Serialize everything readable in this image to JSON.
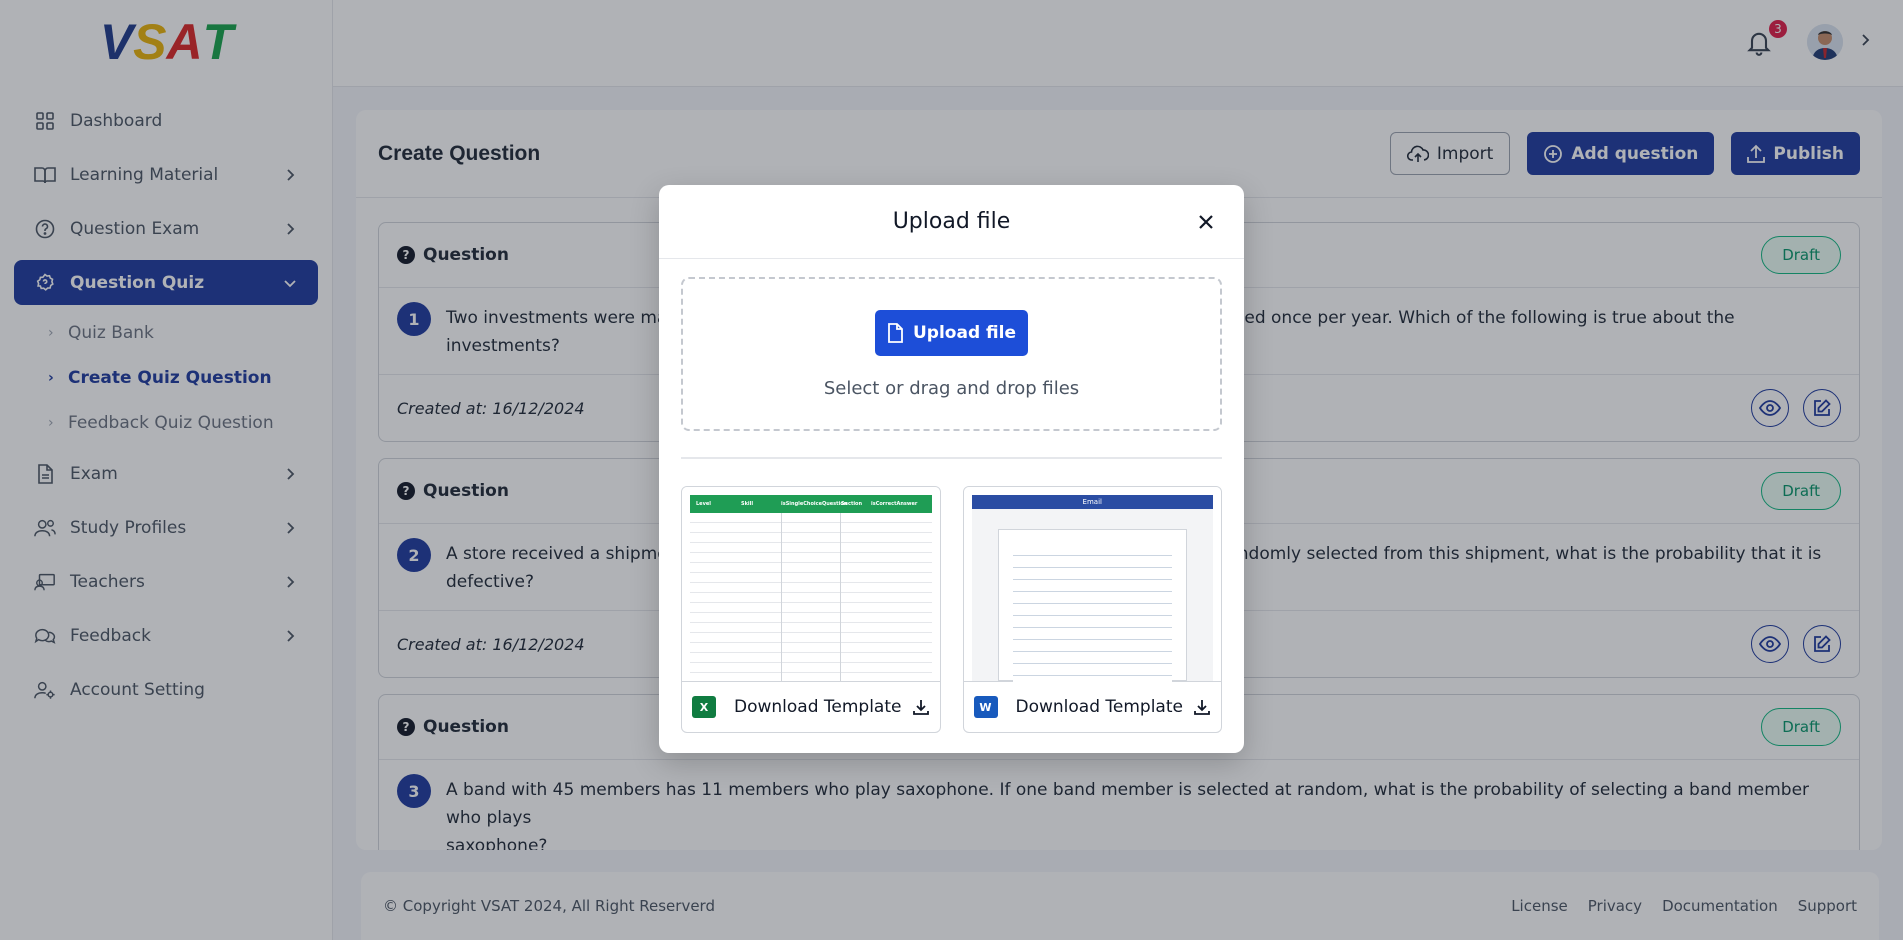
{
  "logo": {
    "text_parts": [
      "V",
      "S",
      "A",
      "T"
    ]
  },
  "sidebar": {
    "items": [
      {
        "label": "Dashboard",
        "icon": "grid-icon"
      },
      {
        "label": "Learning Material",
        "icon": "book-icon"
      },
      {
        "label": "Question Exam",
        "icon": "help-circle-icon"
      },
      {
        "label": "Question Quiz",
        "icon": "quiz-gear-icon"
      },
      {
        "label": "Exam",
        "icon": "document-icon"
      },
      {
        "label": "Study Profiles",
        "icon": "users-icon"
      },
      {
        "label": "Teachers",
        "icon": "teacher-icon"
      },
      {
        "label": "Feedback",
        "icon": "chat-icon"
      },
      {
        "label": "Account Setting",
        "icon": "user-gear-icon"
      }
    ],
    "sub_items": [
      {
        "label": "Quiz Bank"
      },
      {
        "label": "Create Quiz Question"
      },
      {
        "label": "Feedback Quiz Question"
      }
    ]
  },
  "topbar": {
    "notification_count": "3"
  },
  "main": {
    "title": "Create Question",
    "import_label": "Import",
    "add_label": "Add question",
    "publish_label": "Publish",
    "questions": [
      {
        "header": "Question",
        "status": "Draft",
        "number": "1",
        "text_left": "Two investments were ma",
        "text_right": "ed once per year. Which of the following is true about the investments?",
        "created": "Created at: 16/12/2024"
      },
      {
        "header": "Question",
        "status": "Draft",
        "number": "2",
        "text_left": "A store received a shipme",
        "text_right": "ndomly selected from this shipment, what is the probability that it is",
        "text_line2": "defective?",
        "created": "Created at: 16/12/2024"
      },
      {
        "header": "Question",
        "status": "Draft",
        "number": "3",
        "text": "A band with 45 members has 11 members who play saxophone. If one band member is selected at random, what is the probability of selecting a band member who plays",
        "text_line2": "saxophone?"
      }
    ]
  },
  "footer": {
    "copyright": "© Copyright VSAT 2024, All Right Reserverd",
    "links": [
      "License",
      "Privacy",
      "Documentation",
      "Support"
    ]
  },
  "modal": {
    "title": "Upload file",
    "upload_label": "Upload file",
    "hint": "Select or drag and drop files",
    "templates": [
      {
        "label": "Download Template",
        "type": "excel",
        "icon": "excel-icon"
      },
      {
        "label": "Download Template",
        "type": "word",
        "icon": "word-icon"
      }
    ],
    "excel_headers": [
      "Level",
      "Skill",
      "isSingleChoiceQuestion",
      "Section",
      "isCorrectAnswer"
    ],
    "word_header": "Email"
  },
  "colors": {
    "primary": "#1e3a9e",
    "upload": "#1d4ed8",
    "draft": "#10b981",
    "badge": "#e11d48"
  }
}
